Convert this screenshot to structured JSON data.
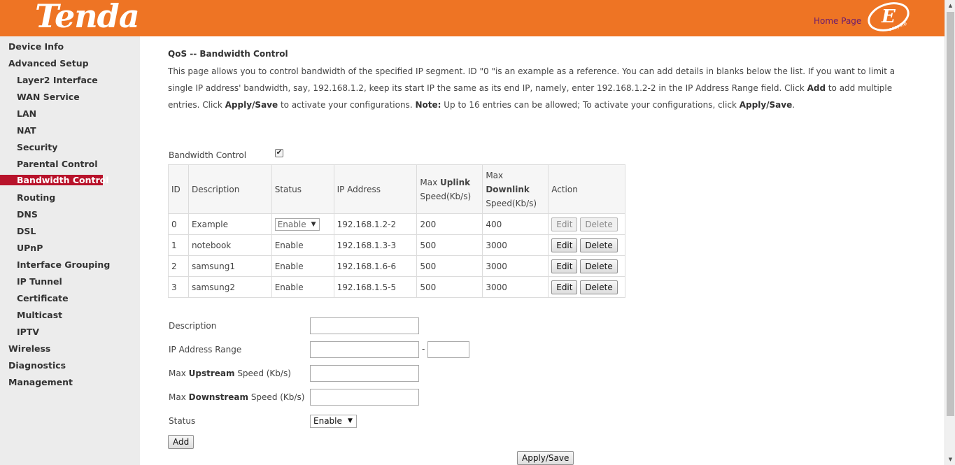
{
  "header": {
    "logo_text": "Tenda",
    "home_link": "Home Page",
    "easylife_text": "easylife",
    "brand_color": "#ee7424"
  },
  "sidebar": {
    "items": [
      {
        "label": "Device Info",
        "level": "top"
      },
      {
        "label": "Advanced Setup",
        "level": "top"
      },
      {
        "label": "Layer2 Interface",
        "level": "sub"
      },
      {
        "label": "WAN Service",
        "level": "sub"
      },
      {
        "label": "LAN",
        "level": "sub"
      },
      {
        "label": "NAT",
        "level": "sub"
      },
      {
        "label": "Security",
        "level": "sub"
      },
      {
        "label": "Parental Control",
        "level": "sub"
      },
      {
        "label": "Bandwidth Control",
        "level": "sub",
        "active": true
      },
      {
        "label": "Routing",
        "level": "sub"
      },
      {
        "label": "DNS",
        "level": "sub"
      },
      {
        "label": "DSL",
        "level": "sub"
      },
      {
        "label": "UPnP",
        "level": "sub"
      },
      {
        "label": "Interface Grouping",
        "level": "sub"
      },
      {
        "label": "IP Tunnel",
        "level": "sub"
      },
      {
        "label": "Certificate",
        "level": "sub"
      },
      {
        "label": "Multicast",
        "level": "sub"
      },
      {
        "label": "IPTV",
        "level": "sub"
      },
      {
        "label": "Wireless",
        "level": "top"
      },
      {
        "label": "Diagnostics",
        "level": "top"
      },
      {
        "label": "Management",
        "level": "top"
      }
    ],
    "active_color": "#b8132b"
  },
  "page": {
    "title": "QoS -- Bandwidth Control",
    "intro_1": "This page allows you to control bandwidth of the specified IP segment. ID \"0 \"is an example as a reference. You can add details in blanks below the list. If you want to limit a single IP address' bandwidth, say, 192.168.1.2, keep its start IP the same as its end IP, namely, enter 192.168.1.2-2 in the IP Address Range field. Click ",
    "intro_add": "Add",
    "intro_2": " to add multiple entries. Click ",
    "intro_apply": "Apply/Save",
    "intro_3": " to activate your configurations. ",
    "intro_note": "Note:",
    "intro_4": " Up to 16 entries can be allowed; To activate your configurations, click ",
    "intro_apply2": "Apply/Save",
    "intro_5": ".",
    "bandwidth_control_label": "Bandwidth Control",
    "bandwidth_control_checked": true
  },
  "table": {
    "headers": {
      "id": "ID",
      "description": "Description",
      "status": "Status",
      "ip": "IP Address",
      "uplink_pre": "Max",
      "uplink_bold": "Uplink",
      "uplink_post": "Speed(Kb/s)",
      "downlink_pre": "Max",
      "downlink_bold": "Downlink",
      "downlink_post": "Speed(Kb/s)",
      "action": "Action"
    },
    "rows": [
      {
        "id": "0",
        "description": "Example",
        "status": "Enable",
        "ip": "192.168.1.2-2",
        "uplink": "200",
        "downlink": "400",
        "edit": "Edit",
        "delete": "Delete",
        "disabled": true
      },
      {
        "id": "1",
        "description": "notebook",
        "status": "Enable",
        "ip": "192.168.1.3-3",
        "uplink": "500",
        "downlink": "3000",
        "edit": "Edit",
        "delete": "Delete"
      },
      {
        "id": "2",
        "description": "samsung1",
        "status": "Enable",
        "ip": "192.168.1.6-6",
        "uplink": "500",
        "downlink": "3000",
        "edit": "Edit",
        "delete": "Delete"
      },
      {
        "id": "3",
        "description": "samsung2",
        "status": "Enable",
        "ip": "192.168.1.5-5",
        "uplink": "500",
        "downlink": "3000",
        "edit": "Edit",
        "delete": "Delete"
      }
    ]
  },
  "form": {
    "description_label": "Description",
    "description_value": "",
    "ip_range_label": "IP Address Range",
    "ip_range_start": "",
    "ip_range_dash": "-",
    "ip_range_end": "",
    "upstream_pre": "Max ",
    "upstream_bold": "Upstream",
    "upstream_post": " Speed (Kb/s)",
    "upstream_value": "",
    "downstream_pre": "Max ",
    "downstream_bold": "Downstream",
    "downstream_post": " Speed (Kb/s)",
    "downstream_value": "",
    "status_label": "Status",
    "status_value": "Enable",
    "add_button": "Add",
    "apply_button": "Apply/Save"
  }
}
